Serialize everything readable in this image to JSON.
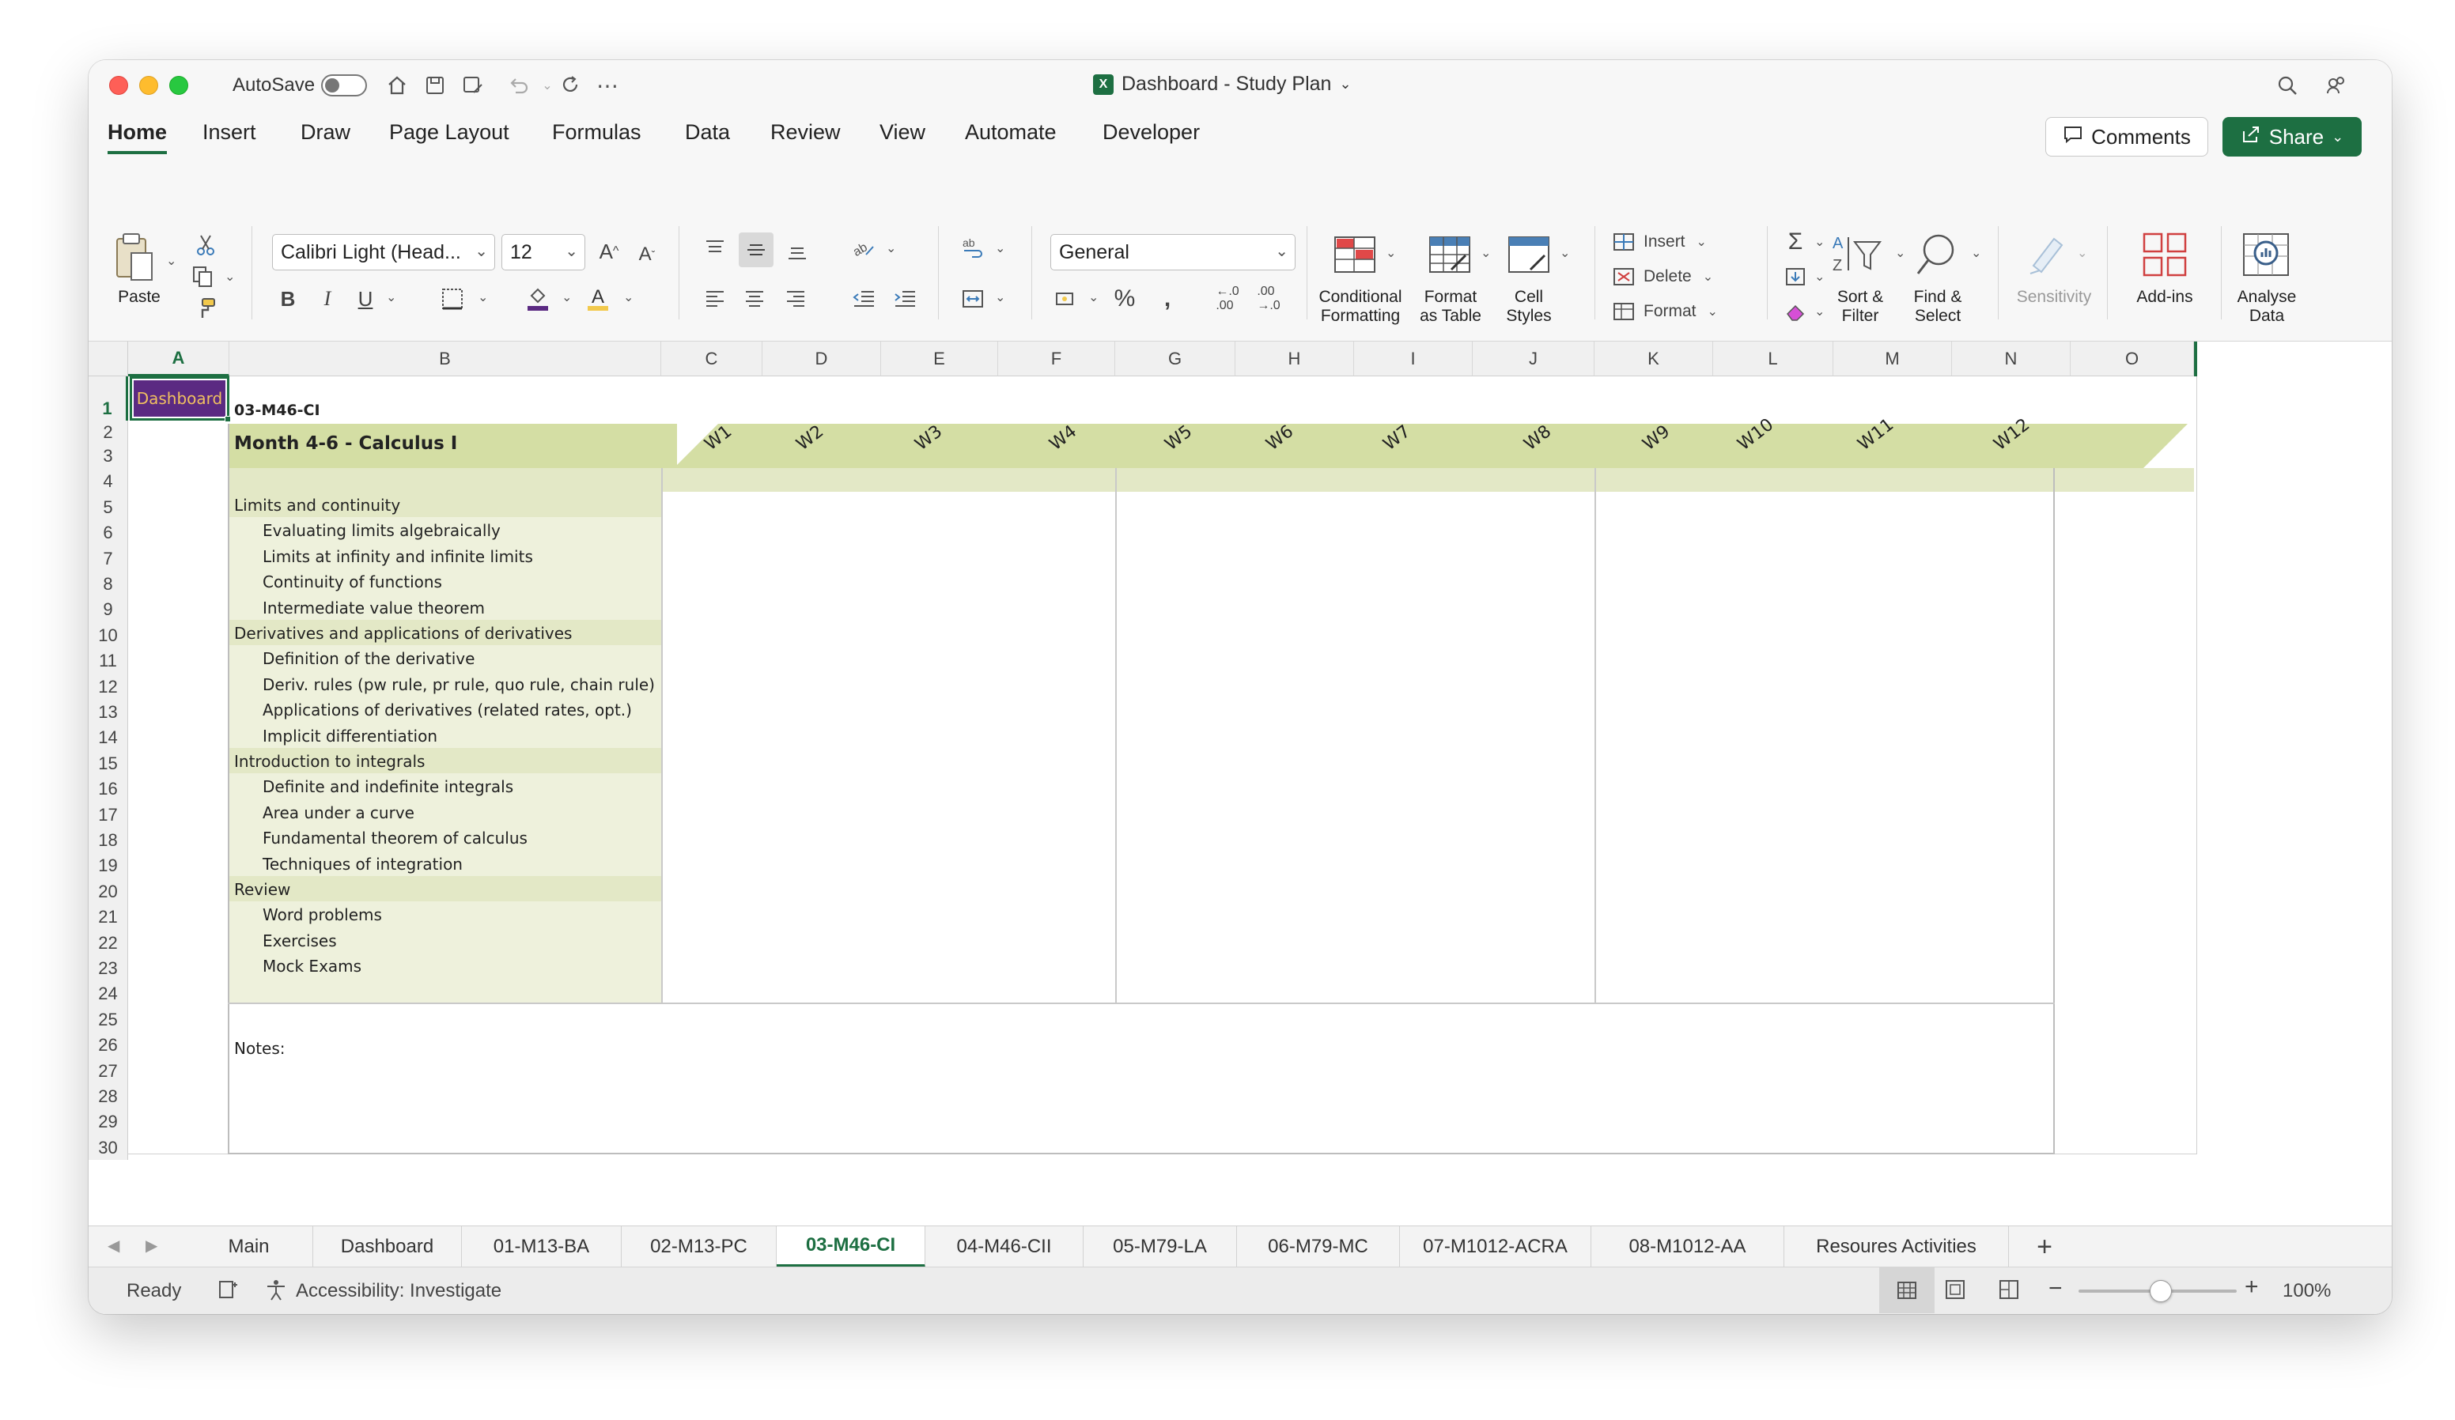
{
  "window": {
    "autosave_label": "AutoSave",
    "title": "Dashboard - Study Plan"
  },
  "ribbon_tabs": [
    "Home",
    "Insert",
    "Draw",
    "Page Layout",
    "Formulas",
    "Data",
    "Review",
    "View",
    "Automate",
    "Developer"
  ],
  "header_buttons": {
    "comments": "Comments",
    "share": "Share"
  },
  "ribbon": {
    "paste": "Paste",
    "font_name": "Calibri Light (Head...",
    "font_size": "12",
    "number_format": "General",
    "conditional_formatting": [
      "Conditional",
      "Formatting"
    ],
    "format_as_table": [
      "Format",
      "as Table"
    ],
    "cell_styles": [
      "Cell",
      "Styles"
    ],
    "insert": "Insert",
    "delete": "Delete",
    "format": "Format",
    "sort_filter": [
      "Sort &",
      "Filter"
    ],
    "find_select": [
      "Find &",
      "Select"
    ],
    "sensitivity": "Sensitivity",
    "addins": "Add-ins",
    "analyse_data": [
      "Analyse",
      "Data"
    ],
    "bold": "B",
    "italic": "I",
    "underline": "U"
  },
  "columns": [
    "A",
    "B",
    "C",
    "D",
    "E",
    "F",
    "G",
    "H",
    "I",
    "J",
    "K",
    "L",
    "M",
    "N",
    "O"
  ],
  "rows": [
    "1",
    "2",
    "3",
    "4",
    "5",
    "6",
    "7",
    "8",
    "9",
    "10",
    "11",
    "12",
    "13",
    "14",
    "15",
    "16",
    "17",
    "18",
    "19",
    "20",
    "21",
    "22",
    "23",
    "24",
    "25",
    "26",
    "27",
    "28",
    "29",
    "30"
  ],
  "sheet": {
    "dashboard_button": "Dashboard",
    "sheet_code": "03-M46-CI",
    "module_title": "Month 4-6 - Calculus I",
    "weeks": [
      "W1",
      "W2",
      "W3",
      "W4",
      "W5",
      "W6",
      "W7",
      "W8",
      "W9",
      "W10",
      "W11",
      "W12"
    ],
    "topics": [
      {
        "text": "Limits and continuity",
        "type": "section"
      },
      {
        "text": "Evaluating limits algebraically",
        "type": "item"
      },
      {
        "text": "Limits at infinity and infinite limits",
        "type": "item"
      },
      {
        "text": "Continuity of functions",
        "type": "item"
      },
      {
        "text": "Intermediate value theorem",
        "type": "item"
      },
      {
        "text": "Derivatives and applications of derivatives",
        "type": "section"
      },
      {
        "text": "Definition of the derivative",
        "type": "item"
      },
      {
        "text": "Deriv. rules (pw rule, pr rule, quo rule, chain rule)",
        "type": "item"
      },
      {
        "text": "Applications of derivatives (related rates, opt.)",
        "type": "item"
      },
      {
        "text": "Implicit differentiation",
        "type": "item"
      },
      {
        "text": "Introduction to integrals",
        "type": "section"
      },
      {
        "text": "Definite and indefinite integrals",
        "type": "item"
      },
      {
        "text": "Area under a curve",
        "type": "item"
      },
      {
        "text": "Fundamental theorem of calculus",
        "type": "item"
      },
      {
        "text": "Techniques of integration",
        "type": "item"
      },
      {
        "text": "Review",
        "type": "section"
      },
      {
        "text": "Word problems",
        "type": "item"
      },
      {
        "text": "Exercises",
        "type": "item"
      },
      {
        "text": "Mock Exams",
        "type": "item"
      }
    ],
    "notes_label": "Notes:"
  },
  "sheet_tabs": [
    "Main",
    "Dashboard",
    "01-M13-BA",
    "02-M13-PC",
    "03-M46-CI",
    "04-M46-CII",
    "05-M79-LA",
    "06-M79-MC",
    "07-M1012-ACRA",
    "08-M1012-AA",
    "Resoures Activities"
  ],
  "active_sheet": "03-M46-CI",
  "status": {
    "ready": "Ready",
    "accessibility": "Accessibility: Investigate",
    "zoom": "100%",
    "zoom_level": 1.0
  },
  "colors": {
    "accent": "#1d6f42",
    "dashboard_fill": "#5b2a82",
    "header_band": "#d4dea4",
    "topic_fill": "#eef1dc"
  }
}
